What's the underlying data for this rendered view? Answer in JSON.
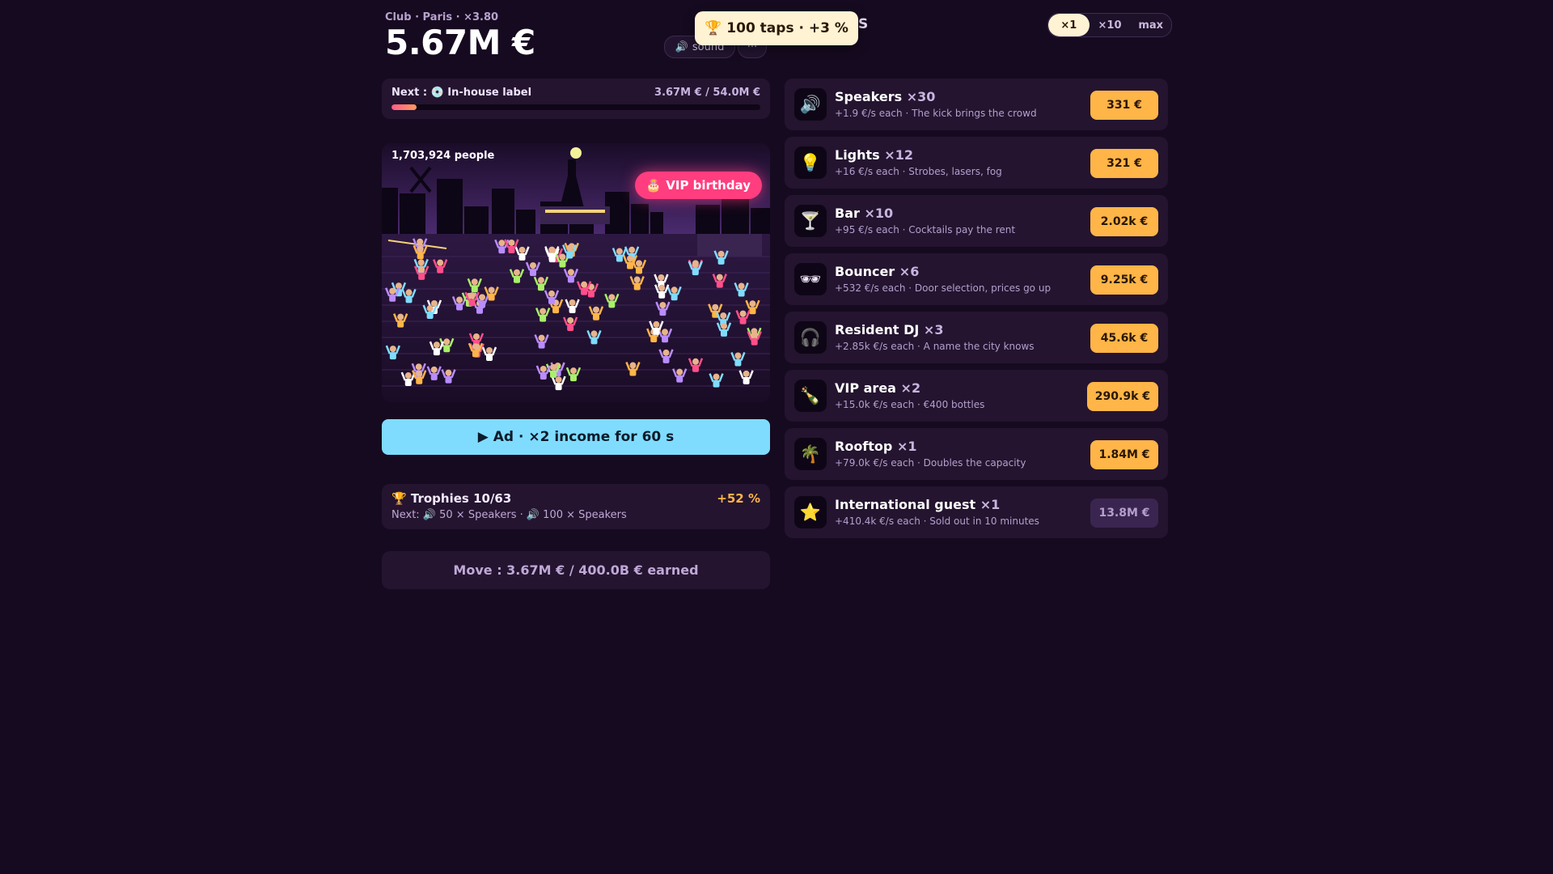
{
  "header": {
    "subtitle": "Club · Paris · ×3.80",
    "money": "5.67M €",
    "sound_label": "sound",
    "sound_icon": "speaker-icon",
    "more_label": "···",
    "toast_icon": "🏆",
    "toast_text": "100 taps · +3 %",
    "toast_tail": "S"
  },
  "multiplier": {
    "options": [
      "×1",
      "×10",
      "max"
    ],
    "selected": "×1"
  },
  "next_goal": {
    "label": "Next : 💿 In-house label",
    "value": "3.67M € / 54.0M €",
    "progress": 0.068
  },
  "club": {
    "people": "1,703,924 people",
    "event_icon": "🎂",
    "event_label": "VIP birthday"
  },
  "ad_button": "▶ Ad · ×2 income for 60 s",
  "trophies": {
    "title": "🏆 Trophies 10/63",
    "bonus": "+52 %",
    "next": "Next: 🔊 50 × Speakers · 🔊 100 × Speakers"
  },
  "move": "Move : 3.67M € / 400.0B € earned",
  "shop": [
    {
      "icon": "🔊",
      "name": "Speakers",
      "count": "×30",
      "desc": "+1.9 €/s each · The kick brings the crowd",
      "price": "331 €",
      "affordable": true
    },
    {
      "icon": "💡",
      "name": "Lights",
      "count": "×12",
      "desc": "+16 €/s each · Strobes, lasers, fog",
      "price": "321 €",
      "affordable": true
    },
    {
      "icon": "🍸",
      "name": "Bar",
      "count": "×10",
      "desc": "+95 €/s each · Cocktails pay the rent",
      "price": "2.02k €",
      "affordable": true
    },
    {
      "icon": "🕶",
      "name": "Bouncer",
      "count": "×6",
      "desc": "+532 €/s each · Door selection, prices go up",
      "price": "9.25k €",
      "affordable": true
    },
    {
      "icon": "🎧",
      "name": "Resident DJ",
      "count": "×3",
      "desc": "+2.85k €/s each · A name the city knows",
      "price": "45.6k €",
      "affordable": true
    },
    {
      "icon": "🍾",
      "name": "VIP area",
      "count": "×2",
      "desc": "+15.0k €/s each · €400 bottles",
      "price": "290.9k €",
      "affordable": true
    },
    {
      "icon": "🌴",
      "name": "Rooftop",
      "count": "×1",
      "desc": "+79.0k €/s each · Doubles the capacity",
      "price": "1.84M €",
      "affordable": true
    },
    {
      "icon": "⭐",
      "name": "International guest",
      "count": "×1",
      "desc": "+410.4k €/s each · Sold out in 10 minutes",
      "price": "13.8M €",
      "affordable": false
    }
  ]
}
